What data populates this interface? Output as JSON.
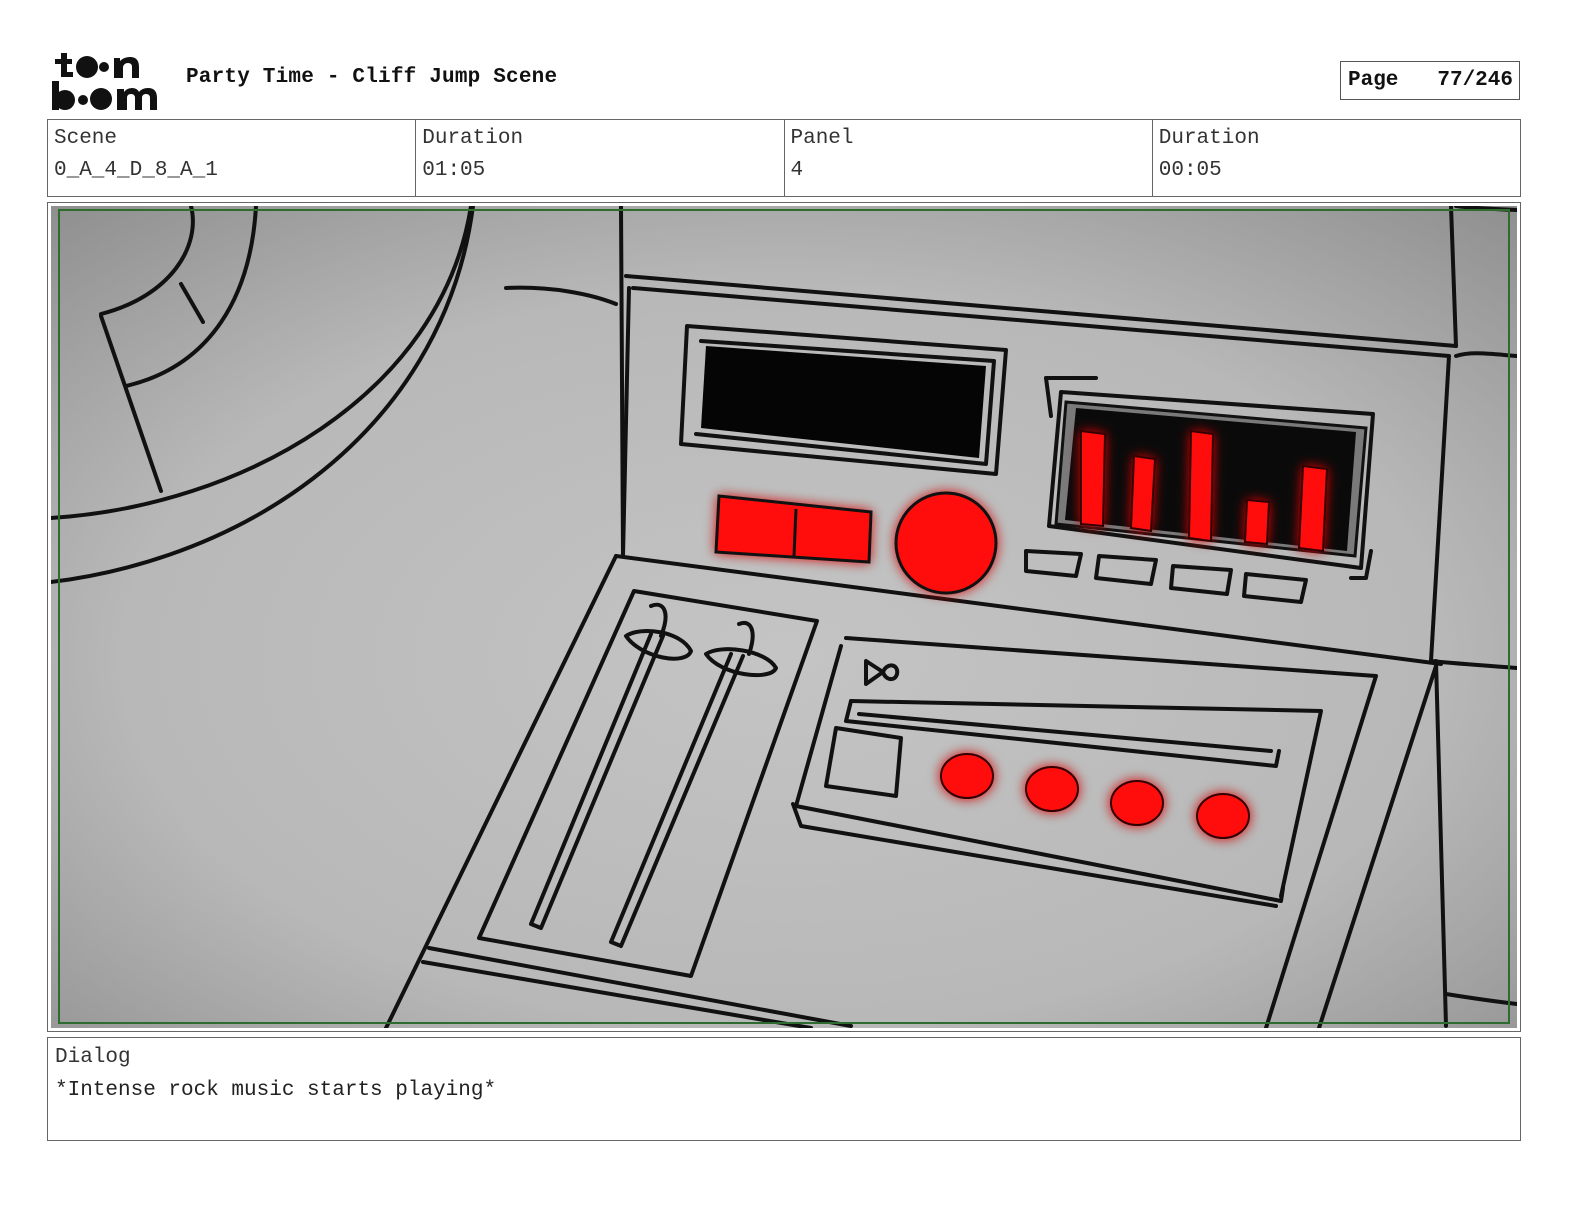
{
  "header": {
    "logo_text": "toon boom",
    "title": "Party Time - Cliff Jump Scene",
    "page_label": "Page",
    "page_value": "77/246"
  },
  "info": {
    "scene_label": "Scene",
    "scene_value": "0_A_4_D_8_A_1",
    "scene_duration_label": "Duration",
    "scene_duration_value": "01:05",
    "panel_label": "Panel",
    "panel_value": "4",
    "panel_duration_label": "Duration",
    "panel_duration_value": "00:05"
  },
  "dialog": {
    "label": "Dialog",
    "text": "*Intense rock music starts playing*"
  },
  "colors": {
    "glow_red": "#ff1010",
    "safe_frame": "#2e6b2e",
    "line": "#111111"
  },
  "icons": {
    "logo": "toon-boom-logo",
    "bow_tie": "bow-tie-icon"
  }
}
